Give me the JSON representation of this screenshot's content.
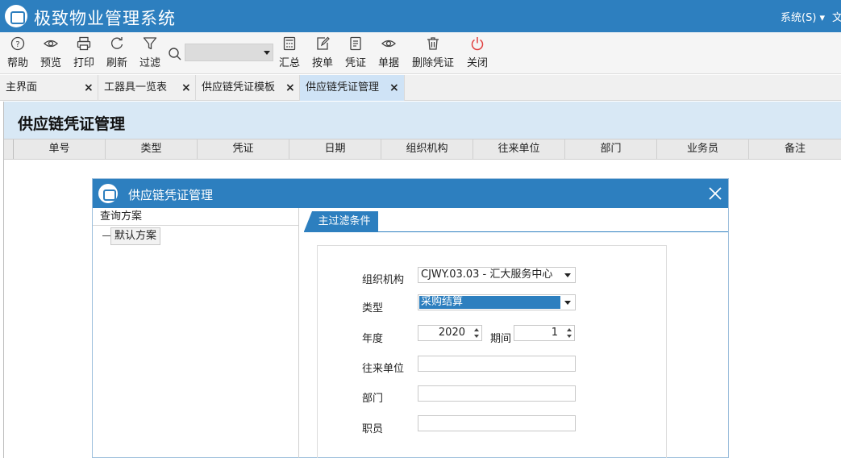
{
  "app": {
    "title": "极致物业管理系统",
    "menu_system": "系统(S)",
    "menu_more": "文"
  },
  "toolbar": {
    "help": "帮助",
    "preview": "预览",
    "print": "打印",
    "refresh": "刷新",
    "filter": "过滤",
    "search_value": "",
    "summary": "汇总",
    "by_document": "按单",
    "voucher": "凭证",
    "document": "单据",
    "delete_voucher": "删除凭证",
    "close": "关闭"
  },
  "tabs": [
    {
      "label": "主界面",
      "close": "×"
    },
    {
      "label": "工器具一览表",
      "close": "×"
    },
    {
      "label": "供应链凭证模板",
      "close": "×"
    },
    {
      "label": "供应链凭证管理",
      "close": "×"
    }
  ],
  "page": {
    "title": "供应链凭证管理"
  },
  "grid": {
    "columns": [
      "单号",
      "类型",
      "凭证",
      "日期",
      "组织机构",
      "往来单位",
      "部门",
      "业务员",
      "备注"
    ]
  },
  "dialog": {
    "title": "供应链凭证管理",
    "plan_header": "查询方案",
    "plan_item": "默认方案",
    "filter_tab": "主过滤条件",
    "fields": {
      "org_label": "组织机构",
      "org_value": "CJWY.03.03  - 汇大服务中心",
      "type_label": "类型",
      "type_value": "采购结算",
      "year_label": "年度",
      "year_value": "2020",
      "period_label": "期间",
      "period_value": "1",
      "partner_label": "往来单位",
      "partner_value": "",
      "dept_label": "部门",
      "dept_value": "",
      "staff_label": "职员",
      "staff_value": ""
    }
  },
  "colors": {
    "brand": "#2d7fbf",
    "header_bg": "#d8e8f5",
    "active_tab": "#cfe3f6"
  }
}
